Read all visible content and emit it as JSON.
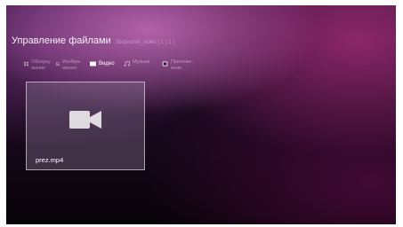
{
  "header": {
    "title": "Управление файлами",
    "subtitle": "Видео/mit_video ( 1 | 1 )"
  },
  "tabs": [
    {
      "label": "Обзорщ- жание",
      "icon": "grid-icon",
      "active": false
    },
    {
      "label": "Изобра- жения",
      "icon": "image-icon",
      "active": false
    },
    {
      "label": "Видео",
      "icon": "video-icon",
      "active": true
    },
    {
      "label": "Музыка",
      "icon": "music-icon",
      "active": false
    },
    {
      "label": "Приложе- ение",
      "icon": "app-icon",
      "active": false
    }
  ],
  "files": [
    {
      "name": "prez.mp4",
      "icon": "video-camera-icon"
    }
  ],
  "colors": {
    "accent": "#ffffff",
    "background_top": "#3a1740",
    "background_bottom": "#070208",
    "card_border": "#c8c0cc"
  }
}
